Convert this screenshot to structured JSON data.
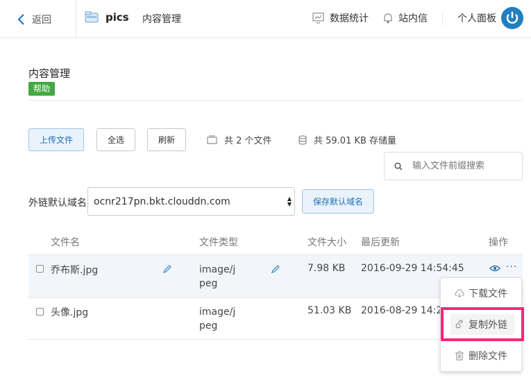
{
  "topbar": {
    "back_label": "返回",
    "bucket_name": "pics",
    "breadcrumb": "内容管理",
    "nav_stats": "数据统计",
    "nav_messages": "站内信",
    "nav_dashboard": "个人面板"
  },
  "header": {
    "title": "内容管理",
    "help_label": "帮助"
  },
  "toolbar": {
    "upload_label": "上传文件",
    "select_all_label": "全选",
    "refresh_label": "刷新",
    "file_count": "共 2 个文件",
    "storage": "共 59.01 KB 存储量",
    "search_placeholder": "输入文件前缀搜索"
  },
  "domain": {
    "label": "外链默认域名",
    "value": "ocnr217pn.bkt.clouddn.com",
    "save_label": "保存默认域名"
  },
  "table": {
    "headers": [
      "文件名",
      "文件类型",
      "文件大小",
      "最后更新",
      "操作"
    ],
    "rows": [
      {
        "name": "乔布斯.jpg",
        "type_line1": "image/j",
        "type_line2": "peg",
        "size": "7.98 KB",
        "updated": "2016-09-29 14:54:45"
      },
      {
        "name": "头像.jpg",
        "type_line1": "image/j",
        "type_line2": "peg",
        "size": "51.03 KB",
        "updated": "2016-08-29 14:26"
      }
    ]
  },
  "menu": {
    "download": "下载文件",
    "copy_link": "复制外链",
    "delete": "删除文件"
  },
  "colors": {
    "accent": "#1e6fb5",
    "help_green": "#44a944",
    "highlight": "#ee2a7b"
  }
}
